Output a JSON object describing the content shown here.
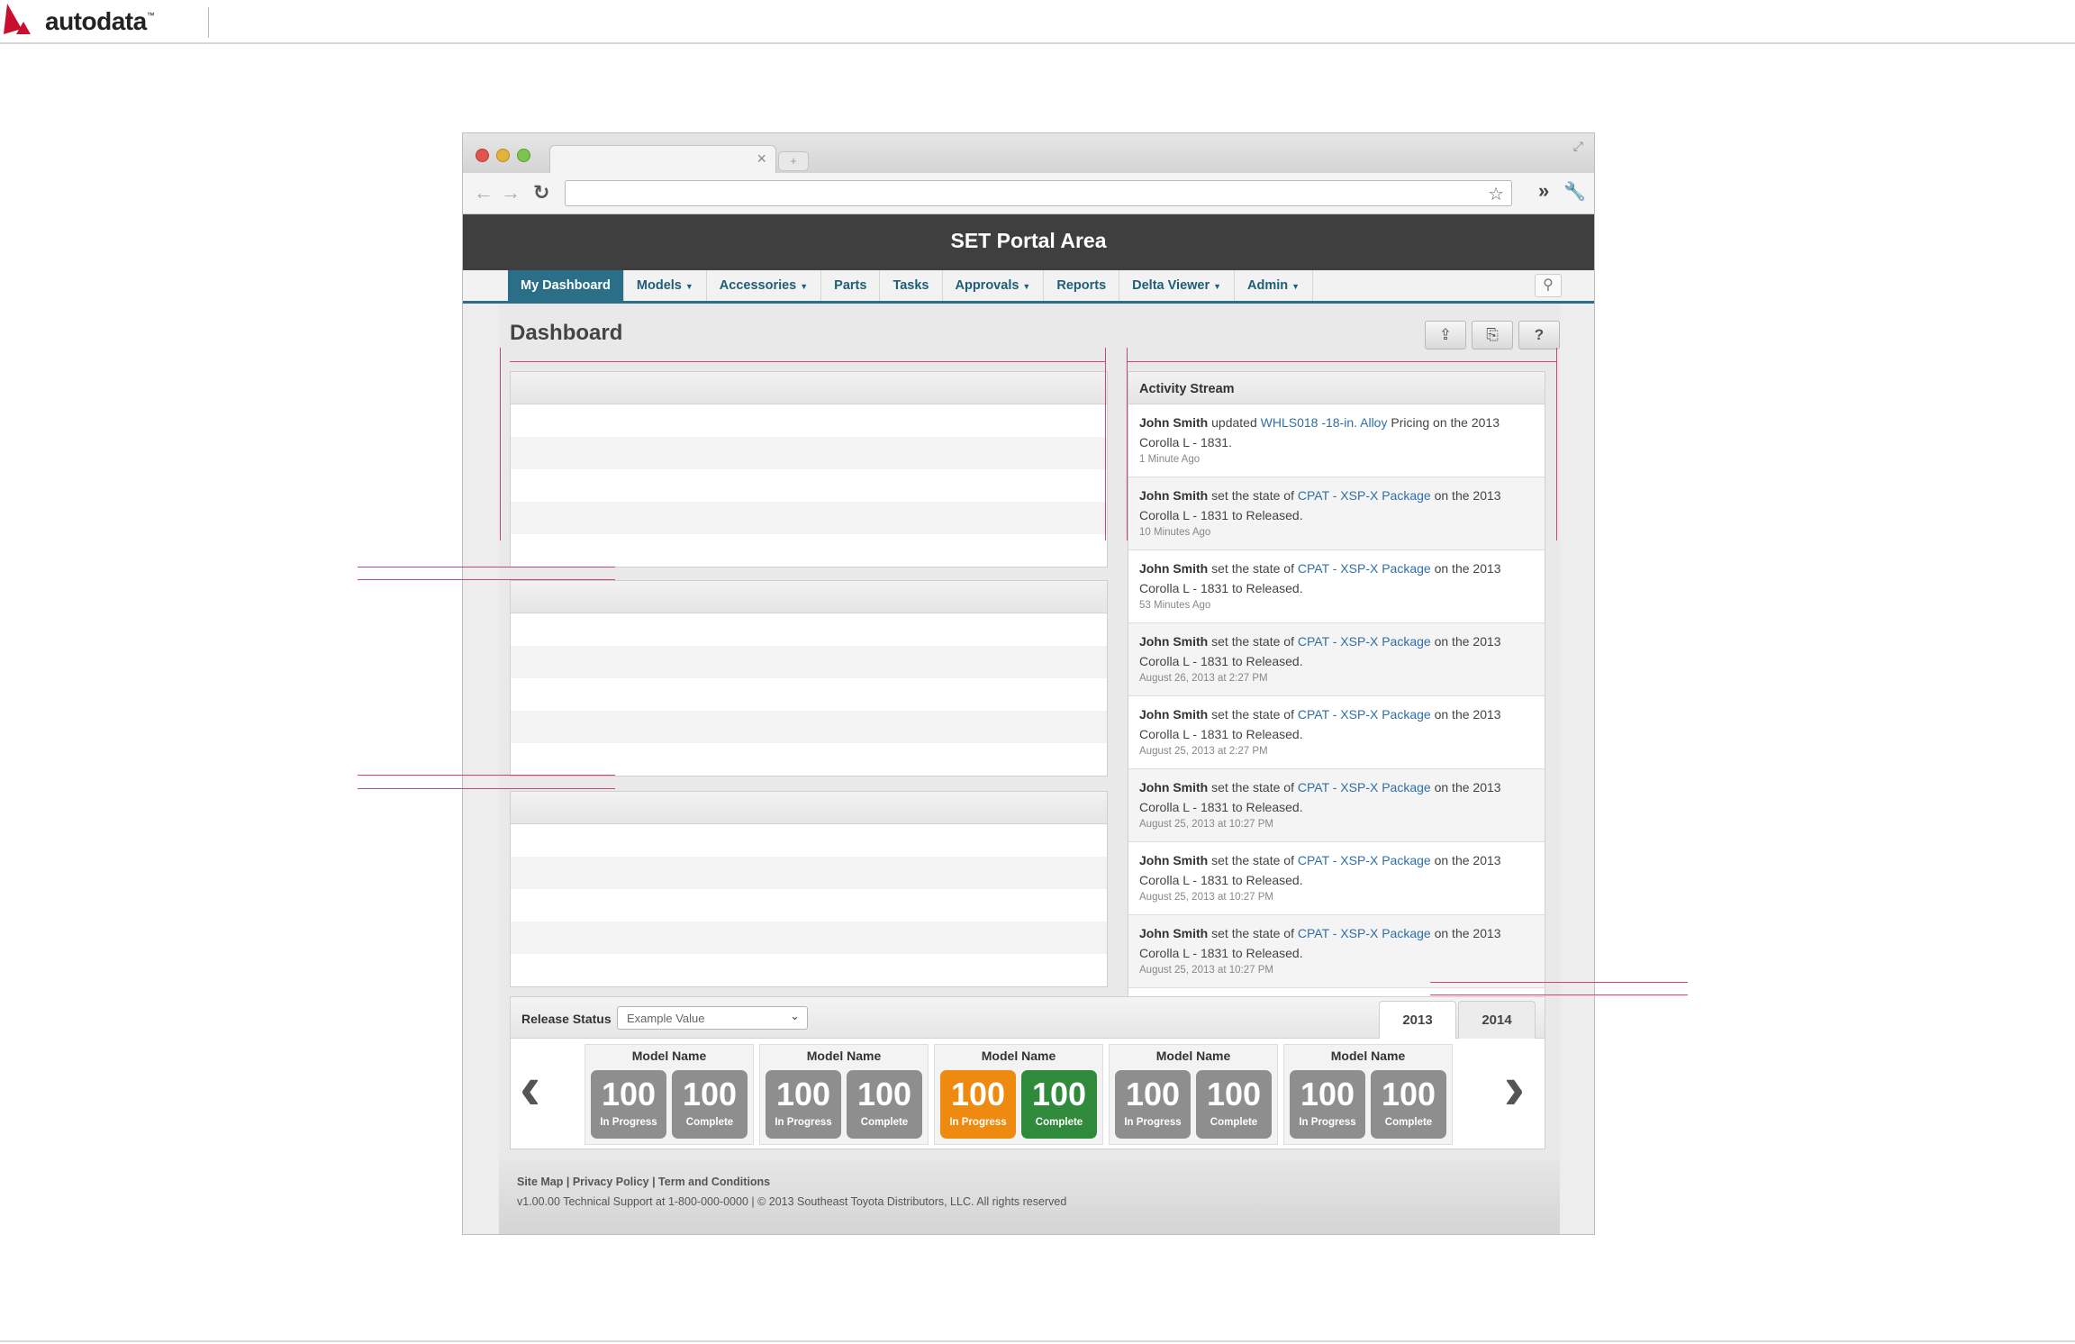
{
  "brand": {
    "name": "autodata",
    "tm": "™"
  },
  "browser": {
    "tab_close": "×",
    "new_tab": "+"
  },
  "app": {
    "title": "SET Portal Area",
    "nav": [
      {
        "label": "My Dashboard",
        "caret": ""
      },
      {
        "label": "Models",
        "caret": "▼"
      },
      {
        "label": "Accessories",
        "caret": "▼"
      },
      {
        "label": "Parts",
        "caret": ""
      },
      {
        "label": "Tasks",
        "caret": ""
      },
      {
        "label": "Approvals",
        "caret": "▼"
      },
      {
        "label": "Reports",
        "caret": ""
      },
      {
        "label": "Delta Viewer",
        "caret": "▼"
      },
      {
        "label": "Admin",
        "caret": "▼"
      }
    ],
    "page_title": "Dashboard"
  },
  "activity": {
    "title": "Activity Stream",
    "items": [
      {
        "user": "John Smith",
        "verb": " updated ",
        "link": "WHLS018 -18-in. Alloy",
        "rest": " Pricing on the 2013 Corolla L - 1831.",
        "time": "1 Minute Ago"
      },
      {
        "user": "John Smith",
        "verb": " set the state of ",
        "link": "CPAT -  XSP-X Package",
        "rest": " on the 2013 Corolla L - 1831 to Released.",
        "time": "10 Minutes Ago"
      },
      {
        "user": "John Smith",
        "verb": " set the state of ",
        "link": "CPAT -  XSP-X Package",
        "rest": " on the 2013 Corolla L - 1831 to Released.",
        "time": "53 Minutes Ago"
      },
      {
        "user": "John Smith",
        "verb": " set the state of ",
        "link": "CPAT -  XSP-X Package",
        "rest": " on the 2013 Corolla L - 1831 to Released.",
        "time": "August 26, 2013 at 2:27 PM"
      },
      {
        "user": "John Smith",
        "verb": " set the state of ",
        "link": "CPAT -  XSP-X Package",
        "rest": " on the 2013 Corolla L - 1831 to Released.",
        "time": "August 25, 2013 at 2:27 PM"
      },
      {
        "user": "John Smith",
        "verb": " set the state of ",
        "link": "CPAT -  XSP-X Package",
        "rest": " on the 2013 Corolla L - 1831 to Released.",
        "time": "August 25, 2013 at 10:27 PM"
      },
      {
        "user": "John Smith",
        "verb": " set the state of ",
        "link": "CPAT -  XSP-X Package",
        "rest": " on the 2013 Corolla L - 1831 to Released.",
        "time": "August 25, 2013 at 10:27 PM"
      },
      {
        "user": "John Smith",
        "verb": " set the state of ",
        "link": "CPAT -  XSP-X Package",
        "rest": " on the 2013 Corolla L - 1831 to Released.",
        "time": "August 25, 2013 at 10:27 PM"
      }
    ]
  },
  "release": {
    "label": "Release Status",
    "select_value": "Example Value",
    "years": [
      "2013",
      "2014"
    ],
    "prev": "‹",
    "next": "›",
    "models": [
      {
        "name": "Model Name",
        "in_progress": "100",
        "in_progress_label": "In Progress",
        "complete": "100",
        "complete_label": "Complete"
      },
      {
        "name": "Model Name",
        "in_progress": "100",
        "in_progress_label": "In Progress",
        "complete": "100",
        "complete_label": "Complete"
      },
      {
        "name": "Model Name",
        "in_progress": "100",
        "in_progress_label": "In Progress",
        "complete": "100",
        "complete_label": "Complete"
      },
      {
        "name": "Model Name",
        "in_progress": "100",
        "in_progress_label": "In Progress",
        "complete": "100",
        "complete_label": "Complete"
      },
      {
        "name": "Model Name",
        "in_progress": "100",
        "in_progress_label": "In Progress",
        "complete": "100",
        "complete_label": "Complete"
      }
    ]
  },
  "footer": {
    "links": "Site Map | Privacy Policy | Term and Conditions",
    "copy": "v1.00.00  Technical Support at 1-800-000-0000 | © 2013 Southeast Toyota Distributors, LLC. All rights reserved"
  },
  "colors": {
    "nav_active": "#2b6e87",
    "header": "#3f3f3f",
    "link": "#2f6fa8",
    "in_progress_highlight": "#ee8a10",
    "complete_highlight": "#2f8a3c",
    "annotation": "#d8436a"
  }
}
